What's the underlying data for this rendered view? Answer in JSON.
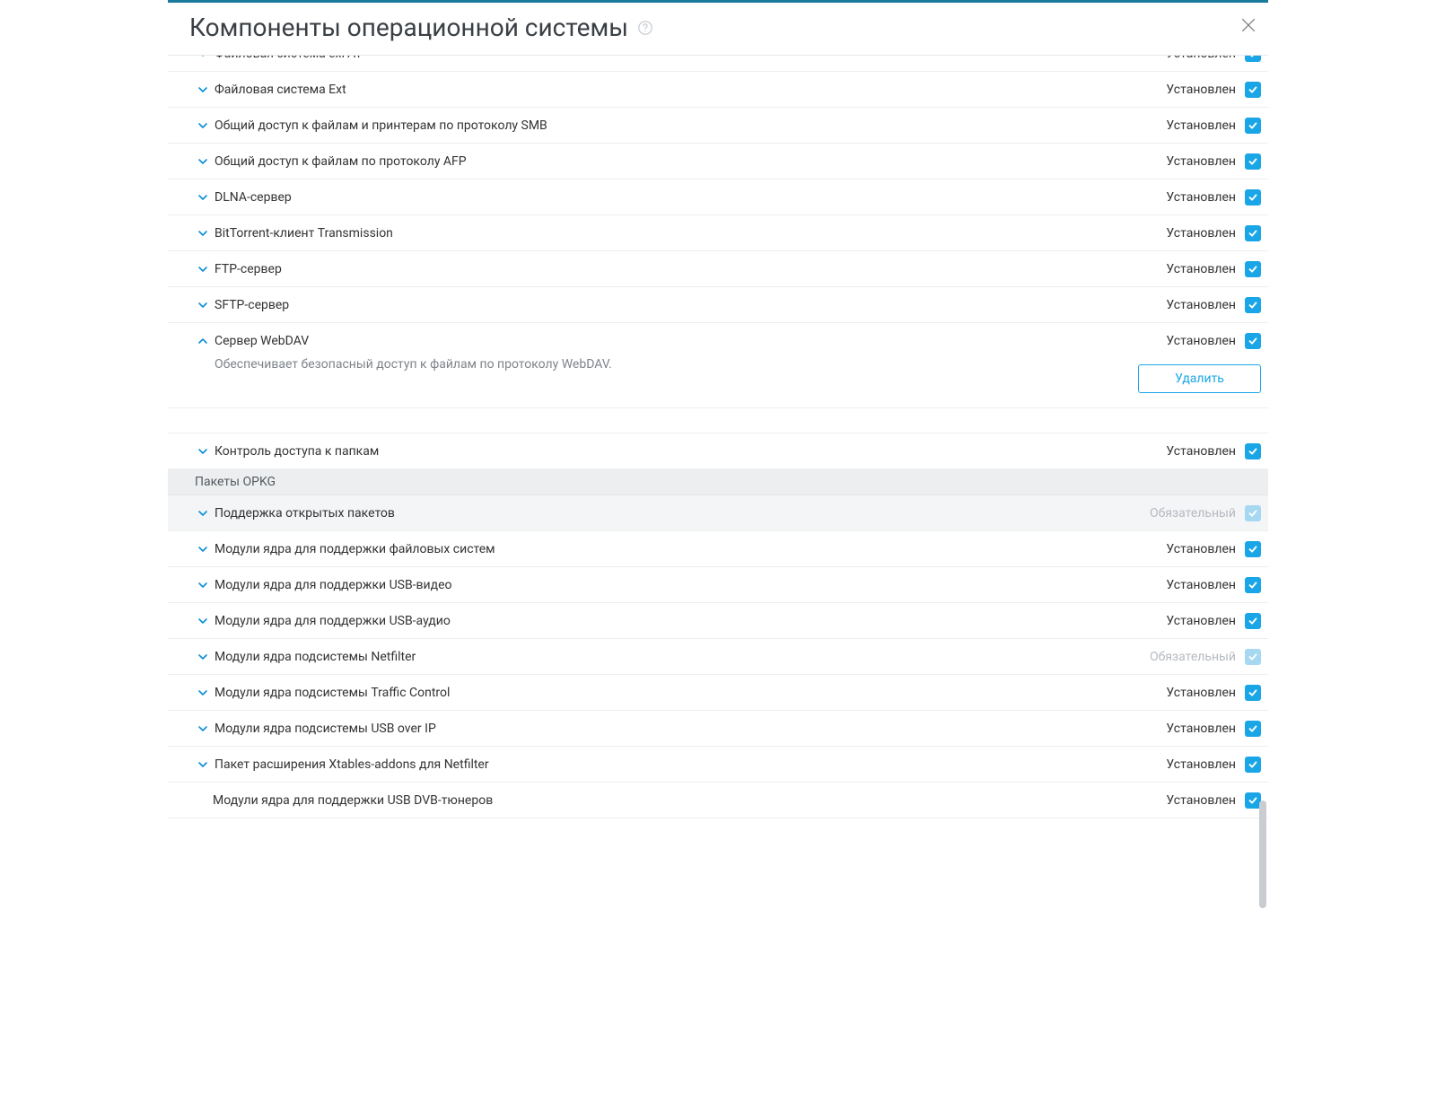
{
  "dialog": {
    "title": "Компоненты операционной системы",
    "delete_label": "Удалить"
  },
  "status": {
    "installed": "Установлен",
    "mandatory": "Обязательный"
  },
  "rows": [
    {
      "label": "Файловая система exFAT",
      "status": "installed",
      "chevron": "down"
    },
    {
      "label": "Файловая система Ext",
      "status": "installed",
      "chevron": "down"
    },
    {
      "label": "Общий доступ к файлам и принтерам по протоколу SMB",
      "status": "installed",
      "chevron": "down"
    },
    {
      "label": "Общий доступ к файлам по протоколу AFP",
      "status": "installed",
      "chevron": "down"
    },
    {
      "label": "DLNA-сервер",
      "status": "installed",
      "chevron": "down"
    },
    {
      "label": "BitTorrent-клиент Transmission",
      "status": "installed",
      "chevron": "down"
    },
    {
      "label": "FTP-сервер",
      "status": "installed",
      "chevron": "down"
    },
    {
      "label": "SFTP-сервер",
      "status": "installed",
      "chevron": "down"
    }
  ],
  "expanded": {
    "label": "Сервер WebDAV",
    "status": "installed",
    "description": "Обеспечивает безопасный доступ к файлам по протоколу WebDAV."
  },
  "row_after_expanded": {
    "label": "Контроль доступа к папкам",
    "status": "installed",
    "chevron": "down"
  },
  "section": {
    "title": "Пакеты OPKG"
  },
  "rows2": [
    {
      "label": "Поддержка открытых пакетов",
      "status": "mandatory",
      "chevron": "down",
      "mandatory": true
    },
    {
      "label": "Модули ядра для поддержки файловых систем",
      "status": "installed",
      "chevron": "down"
    },
    {
      "label": "Модули ядра для поддержки USB-видео",
      "status": "installed",
      "chevron": "down"
    },
    {
      "label": "Модули ядра для поддержки USB-аудио",
      "status": "installed",
      "chevron": "down"
    },
    {
      "label": "Модули ядра подсистемы Netfilter",
      "status": "mandatory",
      "chevron": "down",
      "mandatory": true,
      "bg_normal": true
    },
    {
      "label": "Модули ядра подсистемы Traffic Control",
      "status": "installed",
      "chevron": "down"
    },
    {
      "label": "Модули ядра подсистемы USB over IP",
      "status": "installed",
      "chevron": "down"
    },
    {
      "label": "Пакет расширения Xtables-addons для Netfilter",
      "status": "installed",
      "chevron": "down"
    },
    {
      "label": "Модули ядра для поддержки USB DVB-тюнеров",
      "status": "installed",
      "no_chevron": true
    }
  ]
}
